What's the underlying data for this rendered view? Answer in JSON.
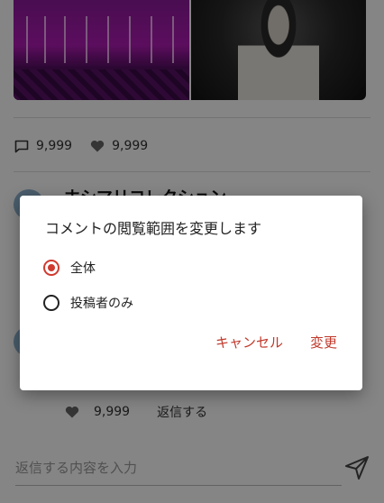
{
  "post": {
    "comment_count": "9,999",
    "like_count": "9,999"
  },
  "comment": {
    "author_name": "ホシマリコレクション"
  },
  "reply": {
    "like_count": "9,999",
    "reply_label": "返信する"
  },
  "input": {
    "placeholder": "返信する内容を入力"
  },
  "dialog": {
    "title": "コメントの閲覧範囲を変更します",
    "options": [
      {
        "label": "全体",
        "selected": true
      },
      {
        "label": "投稿者のみ",
        "selected": false
      }
    ],
    "cancel_label": "キャンセル",
    "confirm_label": "変更",
    "accent_color": "#d03a2f"
  },
  "icons": {
    "comment": "comment-icon",
    "like": "heart-icon",
    "send": "send-icon"
  }
}
